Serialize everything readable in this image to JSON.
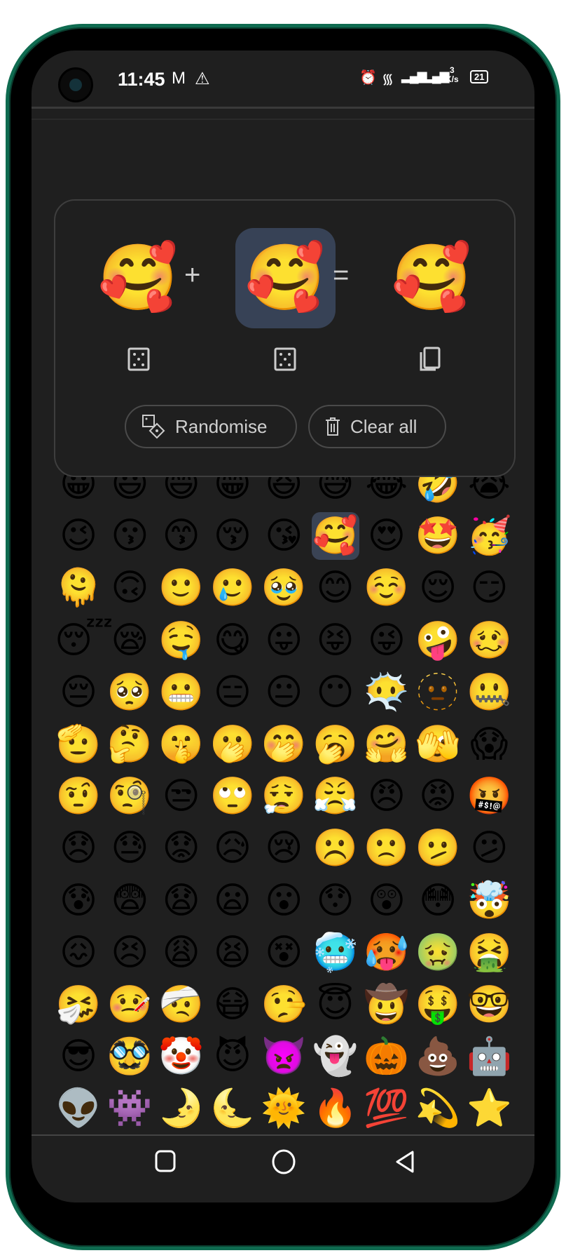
{
  "status_bar": {
    "time": "11:45",
    "left_icons": [
      "gmail-icon",
      "warning-icon"
    ],
    "right_icons": [
      "alarm-icon",
      "wifi-icon",
      "signal-icon",
      "signal-icon"
    ],
    "net_speed_value": "3",
    "net_speed_unit": "K/s",
    "battery": "21"
  },
  "mixer": {
    "first": "🥰",
    "second": "🥰",
    "result": "🥰",
    "plus": "+",
    "equals": "=",
    "randomise_label": "Randomise",
    "clear_label": "Clear all",
    "accent": "#374256"
  },
  "grid": {
    "selected_index": 14,
    "emojis": [
      "😀",
      "😃",
      "😄",
      "😁",
      "😆",
      "😅",
      "😂",
      "🤣",
      "😭",
      "😉",
      "😗",
      "😙",
      "😚",
      "😘",
      "🥰",
      "😍",
      "🤩",
      "🥳",
      "🫠",
      "🙃",
      "🙂",
      "🥲",
      "🥹",
      "😊",
      "☺️",
      "😌",
      "😏",
      "😴",
      "😪",
      "🤤",
      "😋",
      "😛",
      "😝",
      "😜",
      "🤪",
      "🥴",
      "😔",
      "🥺",
      "😬",
      "😑",
      "😐",
      "😶",
      "😶‍🌫️",
      "🫥",
      "🤐",
      "🫡",
      "🤔",
      "🤫",
      "🫢",
      "🤭",
      "🥱",
      "🤗",
      "🫣",
      "😱",
      "🤨",
      "🧐",
      "😒",
      "🙄",
      "😮‍💨",
      "😤",
      "😠",
      "😡",
      "🤬",
      "😞",
      "😓",
      "😟",
      "😥",
      "😢",
      "☹️",
      "🙁",
      "🫤",
      "😕",
      "😰",
      "😨",
      "😧",
      "😦",
      "😮",
      "😯",
      "😲",
      "😳",
      "🤯",
      "😖",
      "😣",
      "😩",
      "😫",
      "😵",
      "🥶",
      "🥵",
      "🤢",
      "🤮",
      "🤧",
      "🤒",
      "🤕",
      "😷",
      "🤥",
      "😇",
      "🤠",
      "🤑",
      "🤓",
      "😎",
      "🥸",
      "🤡",
      "😈",
      "👿",
      "👻",
      "🎃",
      "💩",
      "🤖",
      "👽",
      "👾",
      "🌛",
      "🌜",
      "🌞",
      "🔥",
      "💯",
      "💫",
      "⭐"
    ]
  },
  "nav": {
    "buttons": [
      "recents-button",
      "home-button",
      "back-button"
    ]
  }
}
